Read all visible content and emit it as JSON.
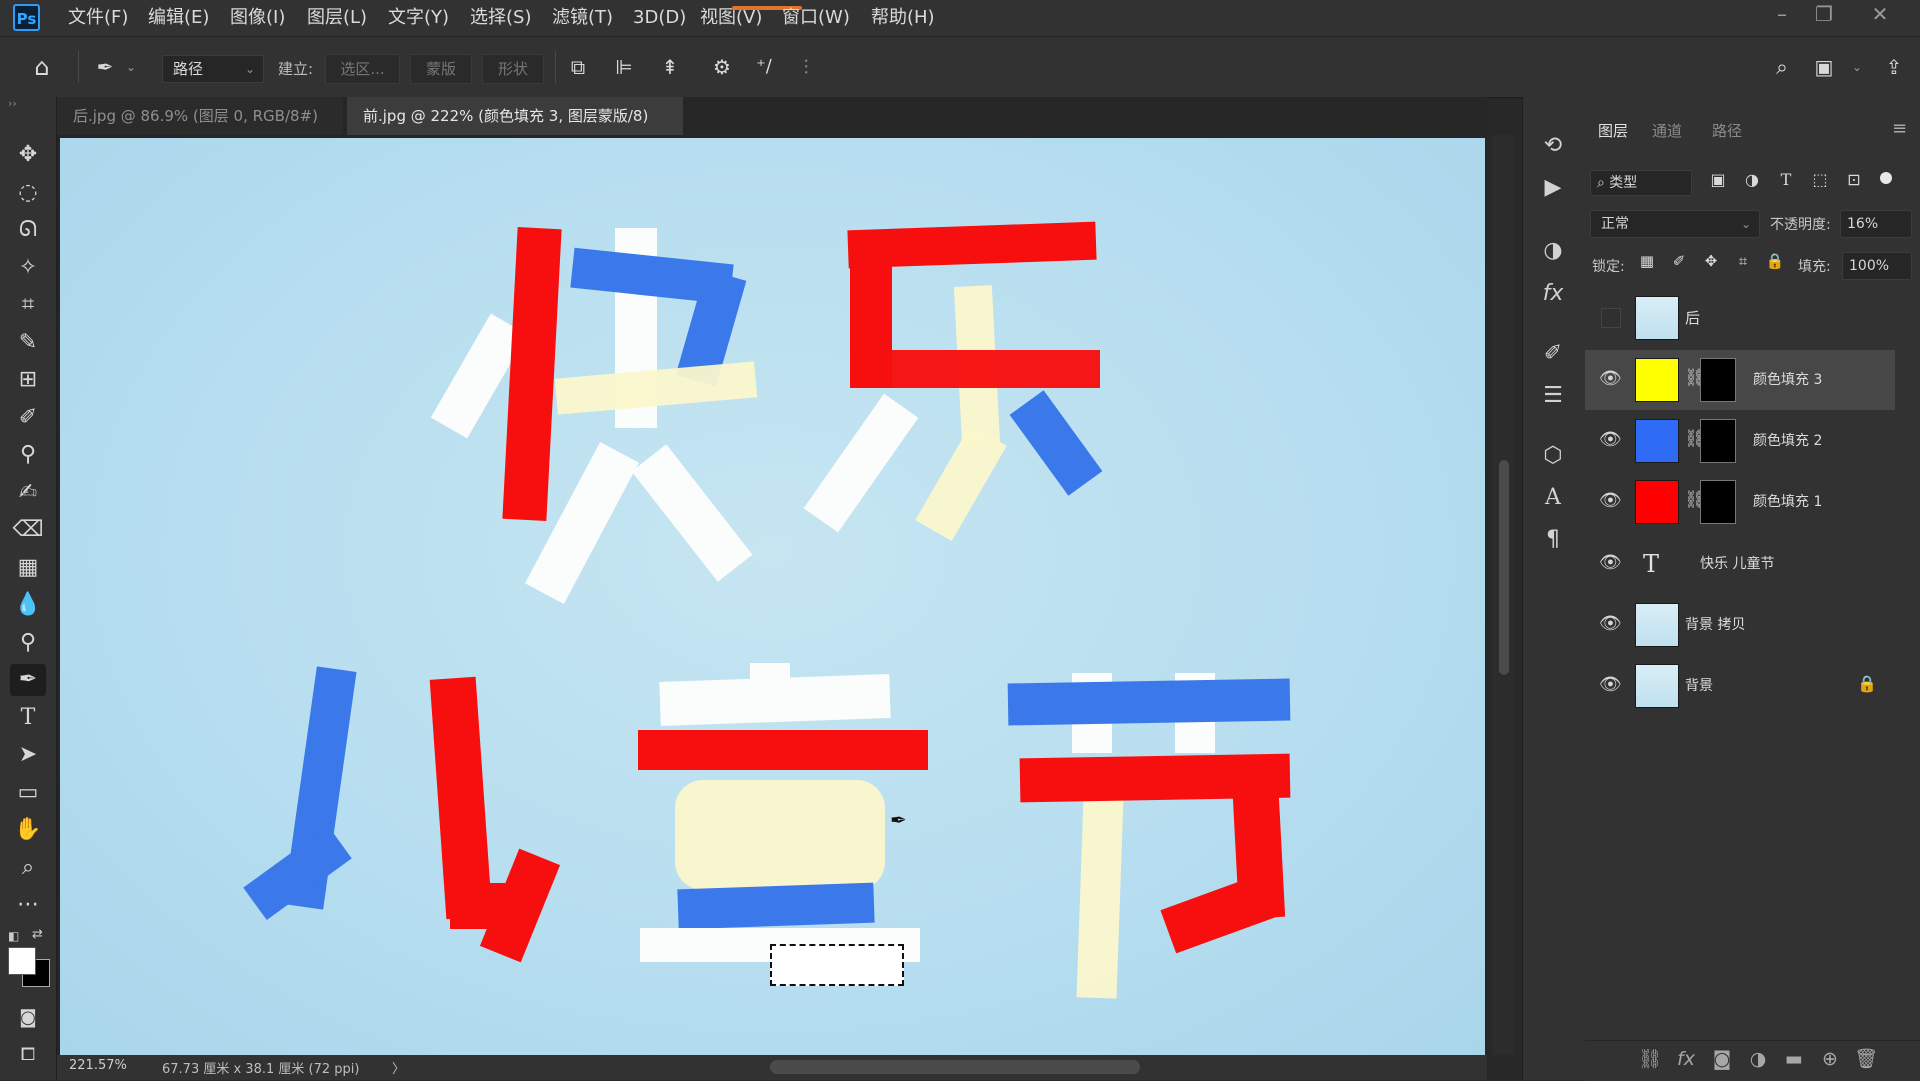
{
  "menu": {
    "logo": "Ps",
    "items": [
      "文件(F)",
      "编辑(E)",
      "图像(I)",
      "图层(L)",
      "文字(Y)",
      "选择(S)",
      "滤镜(T)",
      "3D(D)",
      "视图(V)",
      "窗口(W)",
      "帮助(H)"
    ],
    "window_controls": {
      "minimize": "–",
      "restore": "❐",
      "close": "✕"
    }
  },
  "options": {
    "mode_select": "路径",
    "build_label": "建立:",
    "selection_btn": "选区...",
    "mask_btn": "蒙版",
    "shape_btn": "形状"
  },
  "tabs": [
    {
      "label": "后.jpg @ 86.9% (图层 0, RGB/8#) *",
      "close": "✕",
      "active": false
    },
    {
      "label": "前.jpg @ 222% (颜色填充 3, 图层蒙版/8) *",
      "close": "✕",
      "active": true
    }
  ],
  "status": {
    "zoom": "221.57%",
    "doc_size": "67.73 厘米 x 38.1 厘米 (72 ppi)",
    "arrow": "〉"
  },
  "layers_panel": {
    "tabs": [
      "图层",
      "通道",
      "路径"
    ],
    "filter": "类型",
    "blend_mode": "正常",
    "opacity_label": "不透明度:",
    "opacity_value": "16%",
    "lock_label": "锁定:",
    "fill_label": "填充:",
    "fill_value": "100%",
    "layers": [
      {
        "name": "后",
        "visible": false,
        "thumb": "image",
        "selected": false
      },
      {
        "name": "颜色填充 3",
        "visible": true,
        "thumb": "fill",
        "fill_color": "#ffff00",
        "mask": true,
        "selected": true
      },
      {
        "name": "颜色填充 2",
        "visible": true,
        "thumb": "fill",
        "fill_color": "#2f6cf5",
        "mask": true,
        "selected": false
      },
      {
        "name": "颜色填充 1",
        "visible": true,
        "thumb": "fill",
        "fill_color": "#ff0000",
        "mask": true,
        "selected": false
      },
      {
        "name": "快乐 儿童节",
        "visible": true,
        "thumb": "text",
        "text_icon": "T",
        "selected": false
      },
      {
        "name": "背景 拷贝",
        "visible": true,
        "thumb": "image",
        "selected": false
      },
      {
        "name": "背景",
        "visible": true,
        "thumb": "image",
        "locked": true,
        "selected": false
      }
    ]
  },
  "colors": {
    "red": "#f70f0f",
    "blue": "#3b79ea",
    "cream": "#fbf7cc",
    "ui_bg": "#323232"
  }
}
